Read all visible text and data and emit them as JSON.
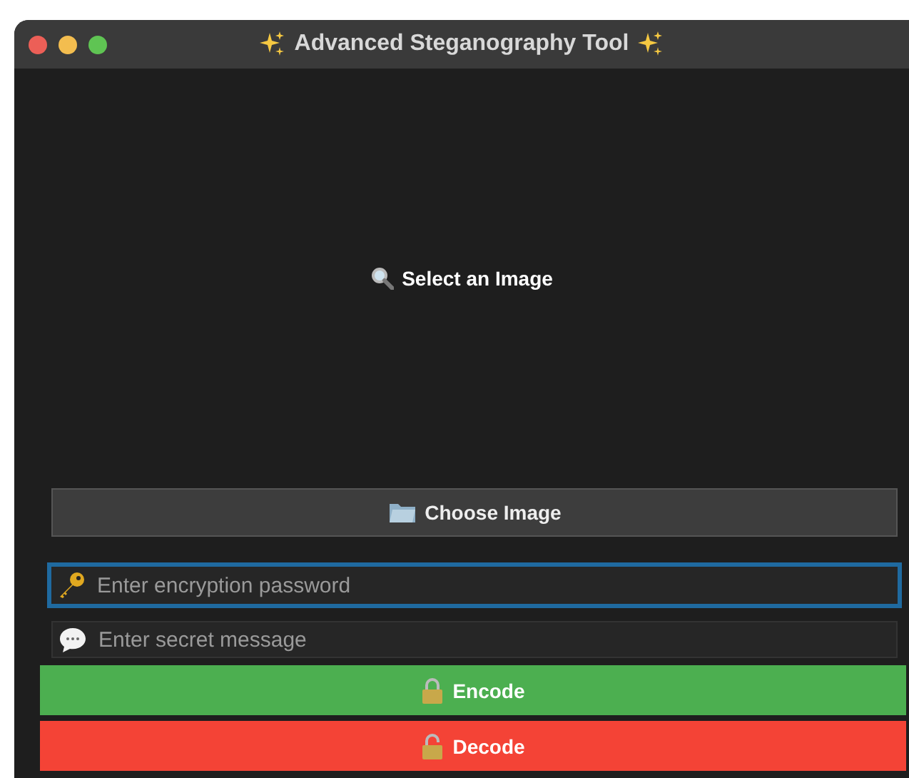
{
  "window": {
    "title": "Advanced Steganography Tool"
  },
  "preview": {
    "label": "Select an Image"
  },
  "choose_button": {
    "label": "Choose Image"
  },
  "fields": [
    {
      "kind": "password",
      "placeholder": "Enter encryption password",
      "focused": true
    },
    {
      "kind": "message",
      "placeholder": "Enter secret message",
      "focused": false
    }
  ],
  "actions": [
    {
      "kind": "encode",
      "label": "Encode",
      "color": "#4caf50"
    },
    {
      "kind": "decode",
      "label": "Decode",
      "color": "#f44336"
    }
  ]
}
